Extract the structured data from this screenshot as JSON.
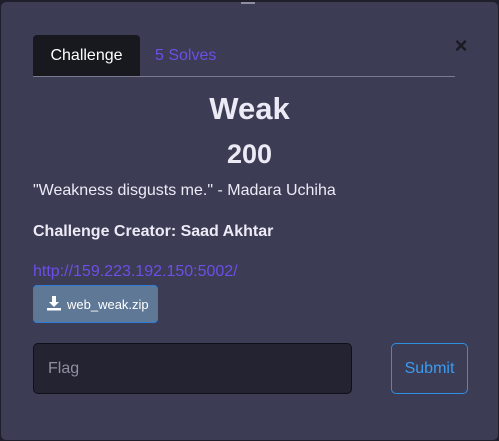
{
  "tabs": {
    "challenge_label": "Challenge",
    "solves_label": "5 Solves"
  },
  "close_label": "×",
  "challenge": {
    "name": "Weak",
    "value": "200",
    "description": "\"Weakness disgusts me.\" - Madara Uchiha",
    "creator": "Challenge Creator: Saad Akhtar",
    "link": "http://159.223.192.150:5002/",
    "file_name": "web_weak.zip"
  },
  "form": {
    "flag_placeholder": "Flag",
    "submit_label": "Submit"
  },
  "icons": {
    "download": "download-icon",
    "close": "close-icon"
  },
  "colors": {
    "background": "#3c3c55",
    "accent": "#6c4fe6",
    "submit": "#3b9cf0"
  }
}
